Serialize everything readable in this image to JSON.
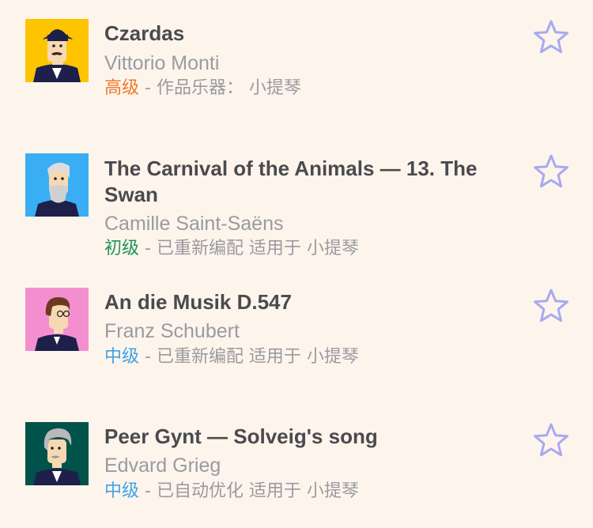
{
  "pieces": [
    {
      "title": "Czardas",
      "composer": "Vittorio Monti",
      "level": "高级",
      "level_color": "#f07a2c",
      "detail": " - 作品乐器： 小提琴",
      "avatar_bg": "#ffc400"
    },
    {
      "title": "The Carnival of the Animals — 13. The Swan",
      "composer": "Camille Saint-Saëns",
      "level": "初级",
      "level_color": "#22935a",
      "detail": " - 已重新编配 适用于 小提琴",
      "avatar_bg": "#3aaef5"
    },
    {
      "title": "An die Musik D.547",
      "composer": "Franz Schubert",
      "level": "中级",
      "level_color": "#3ea2e8",
      "detail": " - 已重新编配 适用于 小提琴",
      "avatar_bg": "#f48fcf"
    },
    {
      "title": "Peer Gynt — Solveig's song",
      "composer": "Edvard Grieg",
      "level": "中级",
      "level_color": "#3ea2e8",
      "detail": " - 已自动优化 适用于 小提琴",
      "avatar_bg": "#00524a"
    }
  ],
  "star_icon": "star-outline-icon",
  "star_color": "#a9a9f2"
}
